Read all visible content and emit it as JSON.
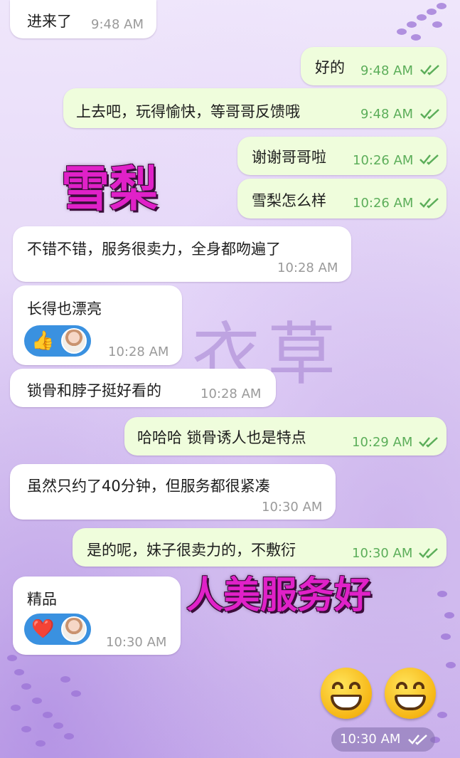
{
  "messages": [
    {
      "text": "进来了",
      "time": "9:48 AM"
    },
    {
      "text": "好的",
      "time": "9:48 AM"
    },
    {
      "text": "上去吧，玩得愉快，等哥哥反馈哦",
      "time": "9:48 AM"
    },
    {
      "text": "谢谢哥哥啦",
      "time": "10:26 AM"
    },
    {
      "text": "雪梨怎么样",
      "time": "10:26 AM"
    },
    {
      "text": "不错不错，服务很卖力，全身都吻遍了",
      "time": "10:28 AM"
    },
    {
      "text": "长得也漂亮",
      "time": "10:28 AM",
      "reaction": "👍"
    },
    {
      "text": "锁骨和脖子挺好看的",
      "time": "10:28 AM"
    },
    {
      "text": "哈哈哈 锁骨诱人也是特点",
      "time": "10:29 AM"
    },
    {
      "text": "虽然只约了40分钟，但服务都很紧凑",
      "time": "10:30 AM"
    },
    {
      "text": "是的呢，妹子很卖力的，不敷衍",
      "time": "10:30 AM"
    },
    {
      "text": "精品",
      "time": "10:30 AM",
      "reaction": "❤️"
    }
  ],
  "last_time": "10:30 AM",
  "overlay": {
    "name": "雪梨",
    "slogan": "人美服务好",
    "watermark": "衣草"
  },
  "colors": {
    "incoming": "#ffffff",
    "outgoing": "#effddc",
    "read_ticks": "#5cae5a",
    "overlay_text": "#e021c8"
  },
  "icons": [
    "double-check-icon",
    "thumbs-up-emoji",
    "heart-emoji",
    "grinning-face-emoji",
    "avatar"
  ]
}
